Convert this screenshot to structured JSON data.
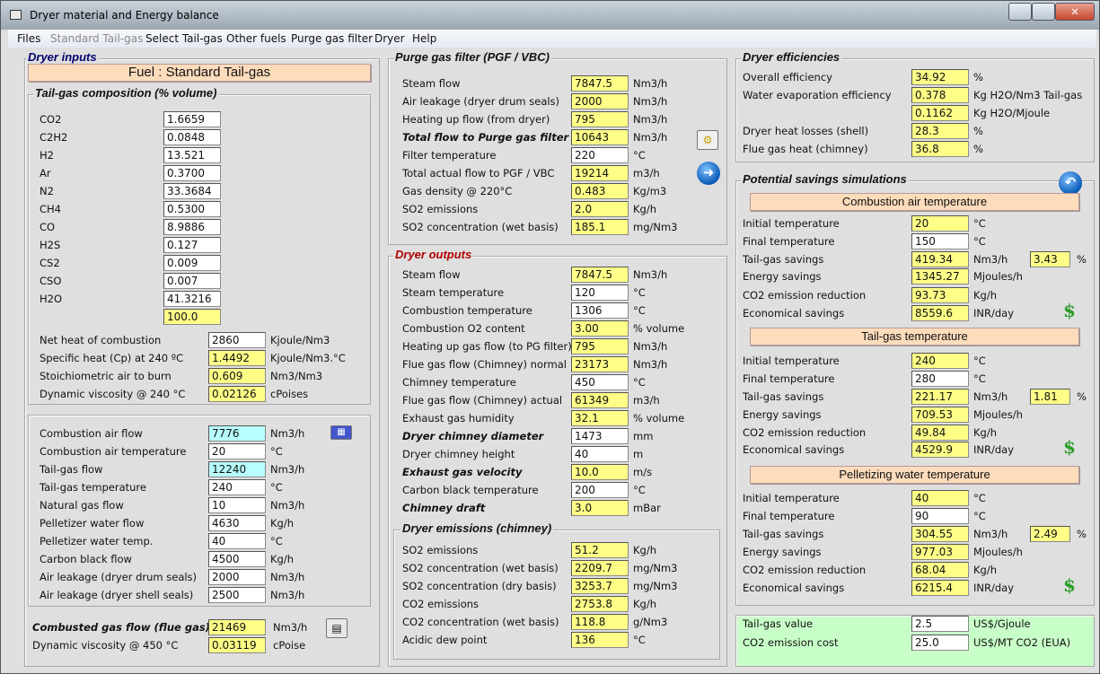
{
  "window": {
    "title": "Dryer material and Energy balance"
  },
  "menu": [
    "Files",
    "Standard Tail-gas",
    "Select Tail-gas",
    "Other fuels",
    "Purge gas filter",
    "Dryer",
    "Help"
  ],
  "dryer_inputs": {
    "title": "Dryer inputs",
    "fuel_banner": "Fuel : Standard Tail-gas",
    "composition_title": "Tail-gas composition (% volume)",
    "composition": [
      {
        "label": "CO2",
        "value": "1.6659",
        "field": "white"
      },
      {
        "label": "C2H2",
        "value": "0.0848",
        "field": "white"
      },
      {
        "label": "H2",
        "value": "13.521",
        "field": "white"
      },
      {
        "label": "Ar",
        "value": "0.3700",
        "field": "white"
      },
      {
        "label": "N2",
        "value": "33.3684",
        "field": "white"
      },
      {
        "label": "CH4",
        "value": "0.5300",
        "field": "white"
      },
      {
        "label": "CO",
        "value": "8.9886",
        "field": "white"
      },
      {
        "label": "H2S",
        "value": "0.127",
        "field": "white"
      },
      {
        "label": "CS2",
        "value": "0.009",
        "field": "white"
      },
      {
        "label": "CSO",
        "value": "0.007",
        "field": "white"
      },
      {
        "label": "H2O",
        "value": "41.3216",
        "field": "white"
      },
      {
        "label": "",
        "value": "100.0",
        "field": "yellow"
      }
    ],
    "properties": [
      {
        "label": "Net heat of combustion",
        "value": "2860",
        "unit": "Kjoule/Nm3",
        "field": "white"
      },
      {
        "label": "Specific heat (Cp) at 240 ºC",
        "value": "1.4492",
        "unit": "Kjoule/Nm3.°C",
        "field": "yellow"
      },
      {
        "label": "Stoichiometric air to burn",
        "value": "0.609",
        "unit": "Nm3/Nm3",
        "field": "yellow"
      },
      {
        "label": "Dynamic viscosity @ 240 °C",
        "value": "0.02126",
        "unit": "cPoises",
        "field": "yellow"
      }
    ],
    "flows": [
      {
        "label": "Combustion air flow",
        "value": "7776",
        "unit": "Nm3/h",
        "field": "cyan"
      },
      {
        "label": "Combustion air temperature",
        "value": "20",
        "unit": "°C",
        "field": "white"
      },
      {
        "label": "Tail-gas flow",
        "value": "12240",
        "unit": "Nm3/h",
        "field": "cyan"
      },
      {
        "label": "Tail-gas temperature",
        "value": "240",
        "unit": "°C",
        "field": "white"
      },
      {
        "label": "Natural gas flow",
        "value": "10",
        "unit": "Nm3/h",
        "field": "white"
      },
      {
        "label": "Pelletizer water flow",
        "value": "4630",
        "unit": "Kg/h",
        "field": "white"
      },
      {
        "label": "Pelletizer water temp.",
        "value": "40",
        "unit": "°C",
        "field": "white"
      },
      {
        "label": "Carbon black flow",
        "value": "4500",
        "unit": "Kg/h",
        "field": "white"
      },
      {
        "label": "Air leakage (dryer drum seals)",
        "value": "2000",
        "unit": "Nm3/h",
        "field": "white"
      },
      {
        "label": "Air leakage (dryer shell seals)",
        "value": "2500",
        "unit": "Nm3/h",
        "field": "white"
      }
    ],
    "flue": [
      {
        "label": "Combusted gas flow (flue gas)",
        "value": "21469",
        "unit": "Nm3/h",
        "field": "yellow",
        "bold": true
      },
      {
        "label": "Dynamic viscosity @ 450 °C",
        "value": "0.03119",
        "unit": "cPoise",
        "field": "yellow"
      }
    ]
  },
  "purge_gas_filter": {
    "title": "Purge gas filter (PGF / VBC)",
    "rows": [
      {
        "label": "Steam flow",
        "value": "7847.5",
        "unit": "Nm3/h",
        "field": "yellow"
      },
      {
        "label": "Air leakage (dryer drum seals)",
        "value": "2000",
        "unit": "Nm3/h",
        "field": "yellow"
      },
      {
        "label": "Heating up flow (from dryer)",
        "value": "795",
        "unit": "Nm3/h",
        "field": "yellow"
      },
      {
        "label": "Total flow to Purge gas filter",
        "value": "10643",
        "unit": "Nm3/h",
        "field": "yellow",
        "bold": true
      },
      {
        "label": "Filter temperature",
        "value": "220",
        "unit": "°C",
        "field": "white"
      },
      {
        "label": "Total actual flow to PGF / VBC",
        "value": "19214",
        "unit": "m3/h",
        "field": "yellow"
      },
      {
        "label": "Gas density @ 220°C",
        "value": "0.483",
        "unit": "Kg/m3",
        "field": "yellow"
      },
      {
        "label": "SO2 emissions",
        "value": "2.0",
        "unit": "Kg/h",
        "field": "yellow"
      },
      {
        "label": "SO2 concentration (wet basis)",
        "value": "185.1",
        "unit": "mg/Nm3",
        "field": "yellow"
      }
    ]
  },
  "dryer_outputs": {
    "title": "Dryer outputs",
    "rows": [
      {
        "label": "Steam flow",
        "value": "7847.5",
        "unit": "Nm3/h",
        "field": "yellow"
      },
      {
        "label": "Steam temperature",
        "value": "120",
        "unit": "°C",
        "field": "white"
      },
      {
        "label": "Combustion temperature",
        "value": "1306",
        "unit": "°C",
        "field": "white"
      },
      {
        "label": "Combustion O2 content",
        "value": "3.00",
        "unit": "% volume",
        "field": "yellow"
      },
      {
        "label": "Heating up gas flow (to PG filter)",
        "value": "795",
        "unit": "Nm3/h",
        "field": "yellow"
      },
      {
        "label": "Flue gas flow (Chimney) normal",
        "value": "23173",
        "unit": "Nm3/h",
        "field": "yellow"
      },
      {
        "label": "Chimney temperature",
        "value": "450",
        "unit": "°C",
        "field": "white"
      },
      {
        "label": "Flue gas flow (Chimney) actual",
        "value": "61349",
        "unit": "m3/h",
        "field": "yellow"
      },
      {
        "label": "Exhaust gas humidity",
        "value": "32.1",
        "unit": "% volume",
        "field": "yellow"
      },
      {
        "label": "Dryer chimney diameter",
        "value": "1473",
        "unit": "mm",
        "field": "white",
        "bold": true
      },
      {
        "label": "Dryer chimney height",
        "value": "40",
        "unit": "m",
        "field": "white"
      },
      {
        "label": "Exhaust gas velocity",
        "value": "10.0",
        "unit": "m/s",
        "field": "yellow",
        "bold": true
      },
      {
        "label": "Carbon black temperature",
        "value": "200",
        "unit": "°C",
        "field": "white"
      },
      {
        "label": "Chimney draft",
        "value": "3.0",
        "unit": "mBar",
        "field": "yellow",
        "bold": true
      }
    ],
    "emissions_title": "Dryer emissions (chimney)",
    "emissions": [
      {
        "label": "SO2 emissions",
        "value": "51.2",
        "unit": "Kg/h",
        "field": "yellow"
      },
      {
        "label": "SO2 concentration (wet basis)",
        "value": "2209.7",
        "unit": "mg/Nm3",
        "field": "yellow"
      },
      {
        "label": "SO2 concentration (dry basis)",
        "value": "3253.7",
        "unit": "mg/Nm3",
        "field": "yellow"
      },
      {
        "label": "CO2 emissions",
        "value": "2753.8",
        "unit": "Kg/h",
        "field": "yellow"
      },
      {
        "label": "CO2 concentration (wet basis)",
        "value": "118.8",
        "unit": "g/Nm3",
        "field": "yellow"
      },
      {
        "label": "Acidic dew point",
        "value": "136",
        "unit": "°C",
        "field": "yellow"
      }
    ]
  },
  "dryer_efficiencies": {
    "title": "Dryer efficiencies",
    "rows": [
      {
        "label": "Overall efficiency",
        "value": "34.92",
        "unit": "%",
        "field": "yellow"
      },
      {
        "label": "Water evaporation efficiency",
        "value": "0.378",
        "unit": "Kg H2O/Nm3 Tail-gas",
        "field": "yellow"
      },
      {
        "label": "",
        "value": "0.1162",
        "unit": "Kg H2O/Mjoule",
        "field": "yellow"
      },
      {
        "label": "Dryer heat losses (shell)",
        "value": "28.3",
        "unit": "%",
        "field": "yellow"
      },
      {
        "label": "Flue gas heat (chimney)",
        "value": "36.8",
        "unit": "%",
        "field": "yellow"
      }
    ]
  },
  "savings": {
    "title": "Potential savings simulations",
    "blocks": [
      {
        "header": "Combustion air temperature",
        "percent": "3.43",
        "percent_unit": "%",
        "rows": [
          {
            "label": "Initial temperature",
            "value": "20",
            "unit": "°C",
            "field": "yellow"
          },
          {
            "label": "Final temperature",
            "value": "150",
            "unit": "°C",
            "field": "white"
          },
          {
            "label": "Tail-gas savings",
            "value": "419.34",
            "unit": "Nm3/h",
            "field": "yellow"
          },
          {
            "label": "Energy savings",
            "value": "1345.27",
            "unit": "Mjoules/h",
            "field": "yellow"
          },
          {
            "label": "CO2 emission reduction",
            "value": "93.73",
            "unit": "Kg/h",
            "field": "yellow"
          },
          {
            "label": "Economical savings",
            "value": "8559.6",
            "unit": "INR/day",
            "field": "yellow"
          }
        ]
      },
      {
        "header": "Tail-gas temperature",
        "percent": "1.81",
        "percent_unit": "%",
        "rows": [
          {
            "label": "Initial temperature",
            "value": "240",
            "unit": "°C",
            "field": "yellow"
          },
          {
            "label": "Final temperature",
            "value": "280",
            "unit": "°C",
            "field": "white"
          },
          {
            "label": "Tail-gas savings",
            "value": "221.17",
            "unit": "Nm3/h",
            "field": "yellow"
          },
          {
            "label": "Energy savings",
            "value": "709.53",
            "unit": "Mjoules/h",
            "field": "yellow"
          },
          {
            "label": "CO2 emission reduction",
            "value": "49.84",
            "unit": "Kg/h",
            "field": "yellow"
          },
          {
            "label": "Economical savings",
            "value": "4529.9",
            "unit": "INR/day",
            "field": "yellow"
          }
        ]
      },
      {
        "header": "Pelletizing water temperature",
        "percent": "2.49",
        "percent_unit": "%",
        "rows": [
          {
            "label": "Initial temperature",
            "value": "40",
            "unit": "°C",
            "field": "yellow"
          },
          {
            "label": "Final temperature",
            "value": "90",
            "unit": "°C",
            "field": "white"
          },
          {
            "label": "Tail-gas savings",
            "value": "304.55",
            "unit": "Nm3/h",
            "field": "yellow"
          },
          {
            "label": "Energy savings",
            "value": "977.03",
            "unit": "Mjoules/h",
            "field": "yellow"
          },
          {
            "label": "CO2 emission reduction",
            "value": "68.04",
            "unit": "Kg/h",
            "field": "yellow"
          },
          {
            "label": "Economical savings",
            "value": "6215.4",
            "unit": "INR/day",
            "field": "yellow"
          }
        ]
      }
    ]
  },
  "costs": {
    "rows": [
      {
        "label": "Tail-gas value",
        "value": "2.5",
        "unit": "US$/Gjoule",
        "field": "white"
      },
      {
        "label": "CO2 emission cost",
        "value": "25.0",
        "unit": "US$/MT CO2 (EUA)",
        "field": "white"
      }
    ]
  },
  "colors": {
    "input_field": "#ffffff",
    "calculated_field": "#ffff88",
    "key_input": "#b8ffff",
    "banner": "#fddcbc",
    "cost_panel": "#c8ffc8"
  }
}
